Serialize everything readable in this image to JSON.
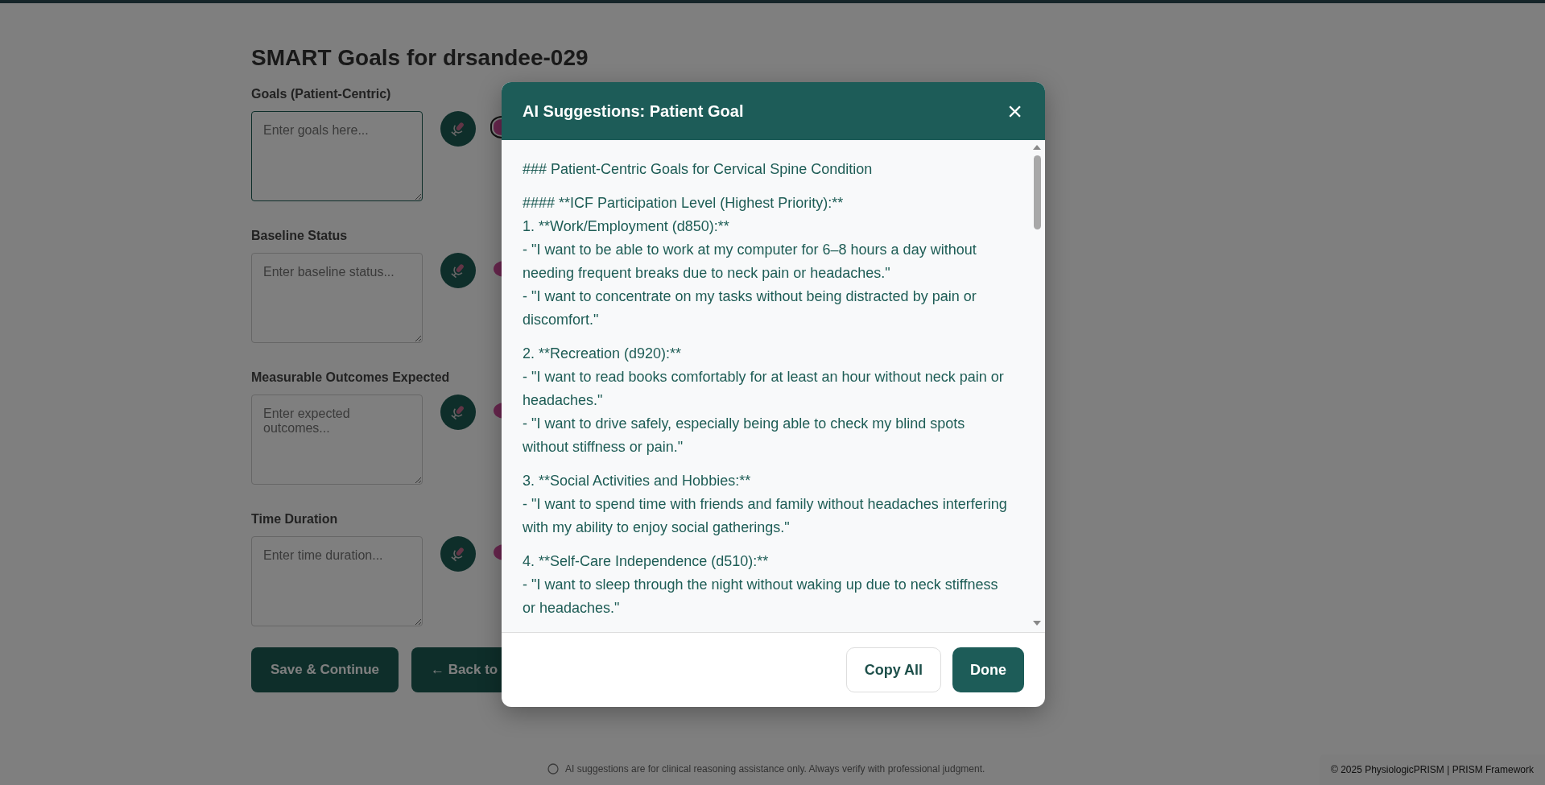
{
  "page": {
    "title": "SMART Goals for drsandee-029",
    "fields": [
      {
        "label": "Goals (Patient-Centric)",
        "placeholder": "Enter goals here...",
        "focused": true
      },
      {
        "label": "Baseline Status",
        "placeholder": "Enter baseline status...",
        "focused": false
      },
      {
        "label": "Measurable Outcomes Expected",
        "placeholder": "Enter expected outcomes...",
        "focused": false
      },
      {
        "label": "Time Duration",
        "placeholder": "Enter time duration...",
        "focused": false
      }
    ],
    "buttons": [
      "Save & Continue",
      "← Back to"
    ],
    "footer": {
      "disclaimer": "AI suggestions are for clinical reasoning assistance only. Always verify with professional judgment.",
      "copyright": "© 2025 PhysiologicPRISM | PRISM Framework"
    }
  },
  "modal": {
    "title": "AI Suggestions: Patient Goal",
    "close": "×",
    "paragraphs": [
      [
        "### Patient-Centric Goals for Cervical Spine Condition"
      ],
      [
        "#### **ICF Participation Level (Highest Priority):**",
        "1. **Work/Employment (d850):**",
        "- \"I want to be able to work at my computer for 6–8 hours a day without needing frequent breaks due to neck pain or headaches.\"",
        "- \"I want to concentrate on my tasks without being distracted by pain or discomfort.\""
      ],
      [
        "2. **Recreation (d920):**",
        "- \"I want to read books comfortably for at least an hour without neck pain or headaches.\"",
        "- \"I want to drive safely, especially being able to check my blind spots without stiffness or pain.\""
      ],
      [
        "3. **Social Activities and Hobbies:**",
        "- \"I want to spend time with friends and family without headaches interfering with my ability to enjoy social gatherings.\""
      ],
      [
        "4. **Self-Care Independence (d510):**",
        "- \"I want to sleep through the night without waking up due to neck stiffness or headaches.\""
      ]
    ],
    "buttons": [
      {
        "label": "Copy All",
        "kind": "secondary"
      },
      {
        "label": "Done",
        "kind": "primary"
      }
    ]
  }
}
